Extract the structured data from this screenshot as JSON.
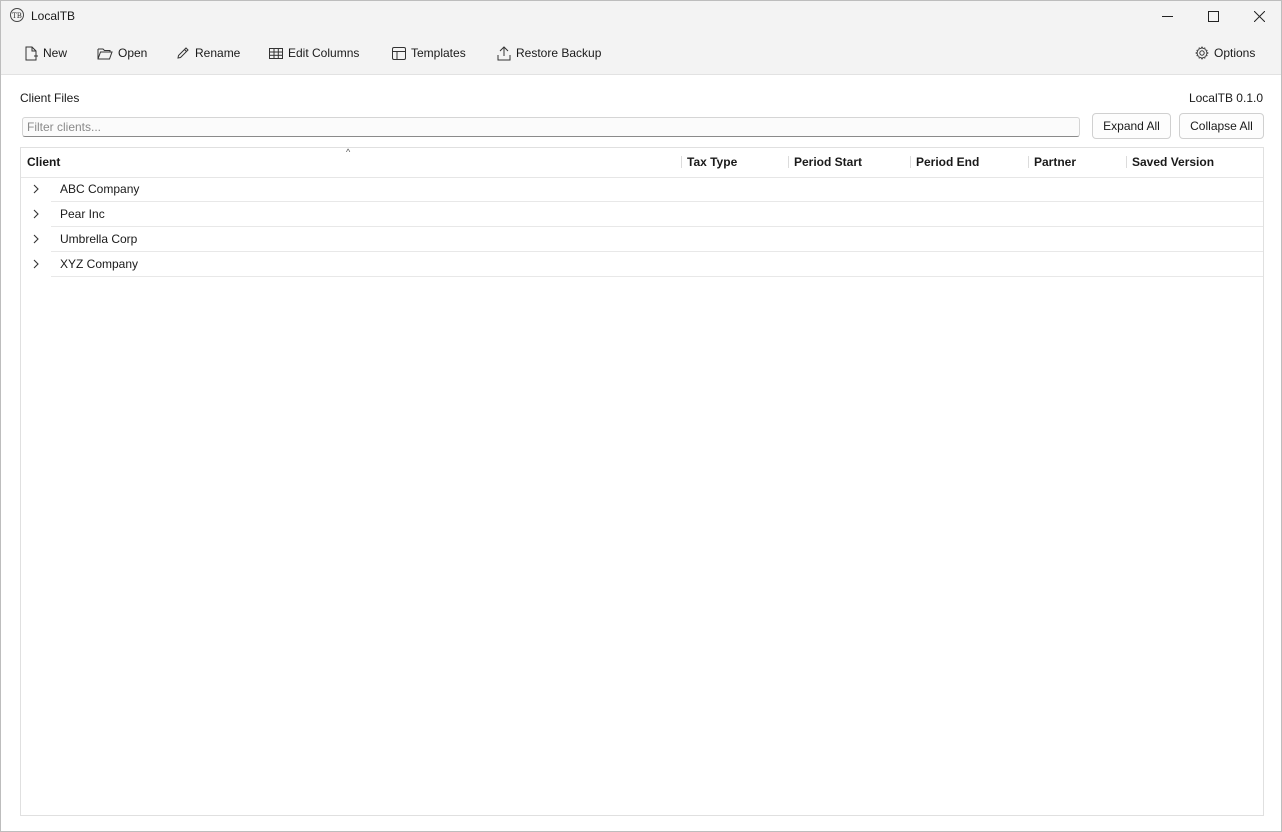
{
  "window": {
    "title": "LocalTB",
    "app_icon_text": "TB"
  },
  "toolbar": {
    "new_label": "New",
    "open_label": "Open",
    "rename_label": "Rename",
    "edit_columns_label": "Edit Columns",
    "templates_label": "Templates",
    "restore_backup_label": "Restore Backup",
    "options_label": "Options"
  },
  "main": {
    "section_title": "Client Files",
    "version": "LocalTB 0.1.0",
    "filter_placeholder": "Filter clients...",
    "expand_all_label": "Expand All",
    "collapse_all_label": "Collapse All"
  },
  "table": {
    "columns": [
      "Client",
      "Tax Type",
      "Period Start",
      "Period End",
      "Partner",
      "Saved Version"
    ],
    "sort_column": "Client",
    "sort_direction": "ascending",
    "rows": [
      {
        "client": "ABC Company",
        "collapsed": true
      },
      {
        "client": "Pear Inc",
        "collapsed": true
      },
      {
        "client": "Umbrella Corp",
        "collapsed": true
      },
      {
        "client": "XYZ Company",
        "collapsed": true
      }
    ]
  },
  "icons": {
    "new": "new-file-icon",
    "open": "folder-open-icon",
    "rename": "pencil-icon",
    "edit_columns": "table-grid-icon",
    "templates": "template-layout-icon",
    "restore_backup": "upload-icon",
    "options": "gear-icon"
  }
}
